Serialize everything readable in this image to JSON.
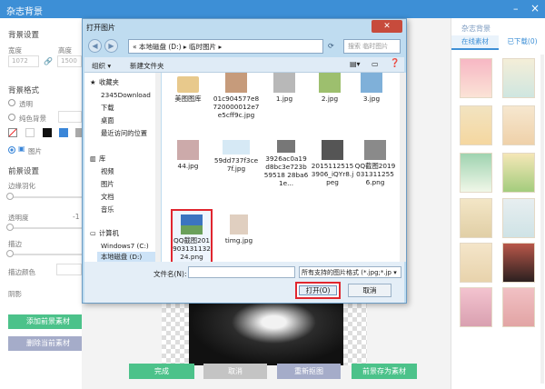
{
  "window": {
    "title": "杂志背景",
    "min": "–",
    "close": "×"
  },
  "left": {
    "bg_settings": "背景设置",
    "width_label": "宽度",
    "height_label": "高度",
    "width_value": "1072",
    "height_value": "1500",
    "bg_style": "背景格式",
    "transparent": "透明",
    "solid": "纯色背景",
    "image": "图片",
    "fg_settings": "前景设置",
    "edge_feather": "边缘羽化",
    "transparency": "透明度",
    "transparency_value": "-1",
    "stroke": "描边",
    "stroke_color": "描边颜色",
    "shadow": "阴影",
    "add_fg": "添加前景素材",
    "del_fg": "删除当前素材"
  },
  "right": {
    "title": "杂志背景",
    "tab_online": "在线素材",
    "tab_downloaded": "已下载(0)"
  },
  "bottom_buttons": {
    "done": "完成",
    "cancel": "取消",
    "recut": "重新抠图",
    "save_fg": "前景存为素材"
  },
  "dialog": {
    "title": "打开图片",
    "close": "✕",
    "back": "◀",
    "forward": "▶",
    "path_root": "«",
    "path": "本地磁盘 (D:)  ▸  临时图片  ▸",
    "search_placeholder": "搜索 临时图片",
    "organize": "组织 ▾",
    "new_folder": "新建文件夹",
    "tree": [
      "收藏夹",
      "2345Download",
      "下载",
      "桌面",
      "最近访问的位置",
      "库",
      "视频",
      "图片",
      "文档",
      "音乐",
      "计算机",
      "Windows7 (C:)",
      "本地磁盘 (D:)"
    ],
    "files": [
      {
        "name": "美图图库",
        "color": "#e8c98c"
      },
      {
        "name": "01c904577e8720000012e7e5cff9c.jpg",
        "color": "#c69b7b"
      },
      {
        "name": "1.jpg",
        "color": "#b8b8b8"
      },
      {
        "name": "2.jpg",
        "color": "#9dbf6e"
      },
      {
        "name": "3.jpg",
        "color": "#7fb0d9"
      },
      {
        "name": "44.jpg",
        "color": "#caa"
      },
      {
        "name": "59dd737f3ce7f.jpg",
        "color": "#d6e9f5"
      },
      {
        "name": "3926ac0a19d8bc3e723b59518 28ba61e...",
        "color": "#777"
      },
      {
        "name": "20151125153906_iQYr8.jpeg",
        "color": "#555"
      },
      {
        "name": "QQ截图20190313112556.png",
        "color": "#8a8a8a"
      },
      {
        "name": "QQ截图20190313113224.png",
        "color": "#3b74c0"
      },
      {
        "name": "timg.jpg",
        "color": "#e0cfc0"
      }
    ],
    "filename_label": "文件名(N):",
    "filetype": "所有支持的图片格式 (*.jpg;*.jp ▾",
    "open": "打开(O)",
    "cancel": "取消"
  }
}
